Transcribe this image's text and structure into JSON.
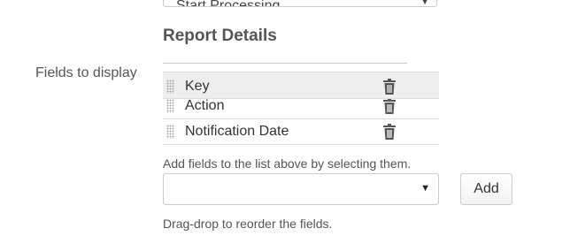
{
  "top_select": {
    "value": "Start Processing"
  },
  "report_details": {
    "title": "Report Details",
    "fields_label": "Fields to display",
    "fields": [
      {
        "label": "Key"
      },
      {
        "label": "Action"
      },
      {
        "label": "Notification Date"
      }
    ],
    "help_add": "Add fields to the list above by selecting them.",
    "field_select": {
      "value": "",
      "caret": "▼"
    },
    "add_label": "Add",
    "help_reorder": "Drag-drop to reorder the fields."
  }
}
